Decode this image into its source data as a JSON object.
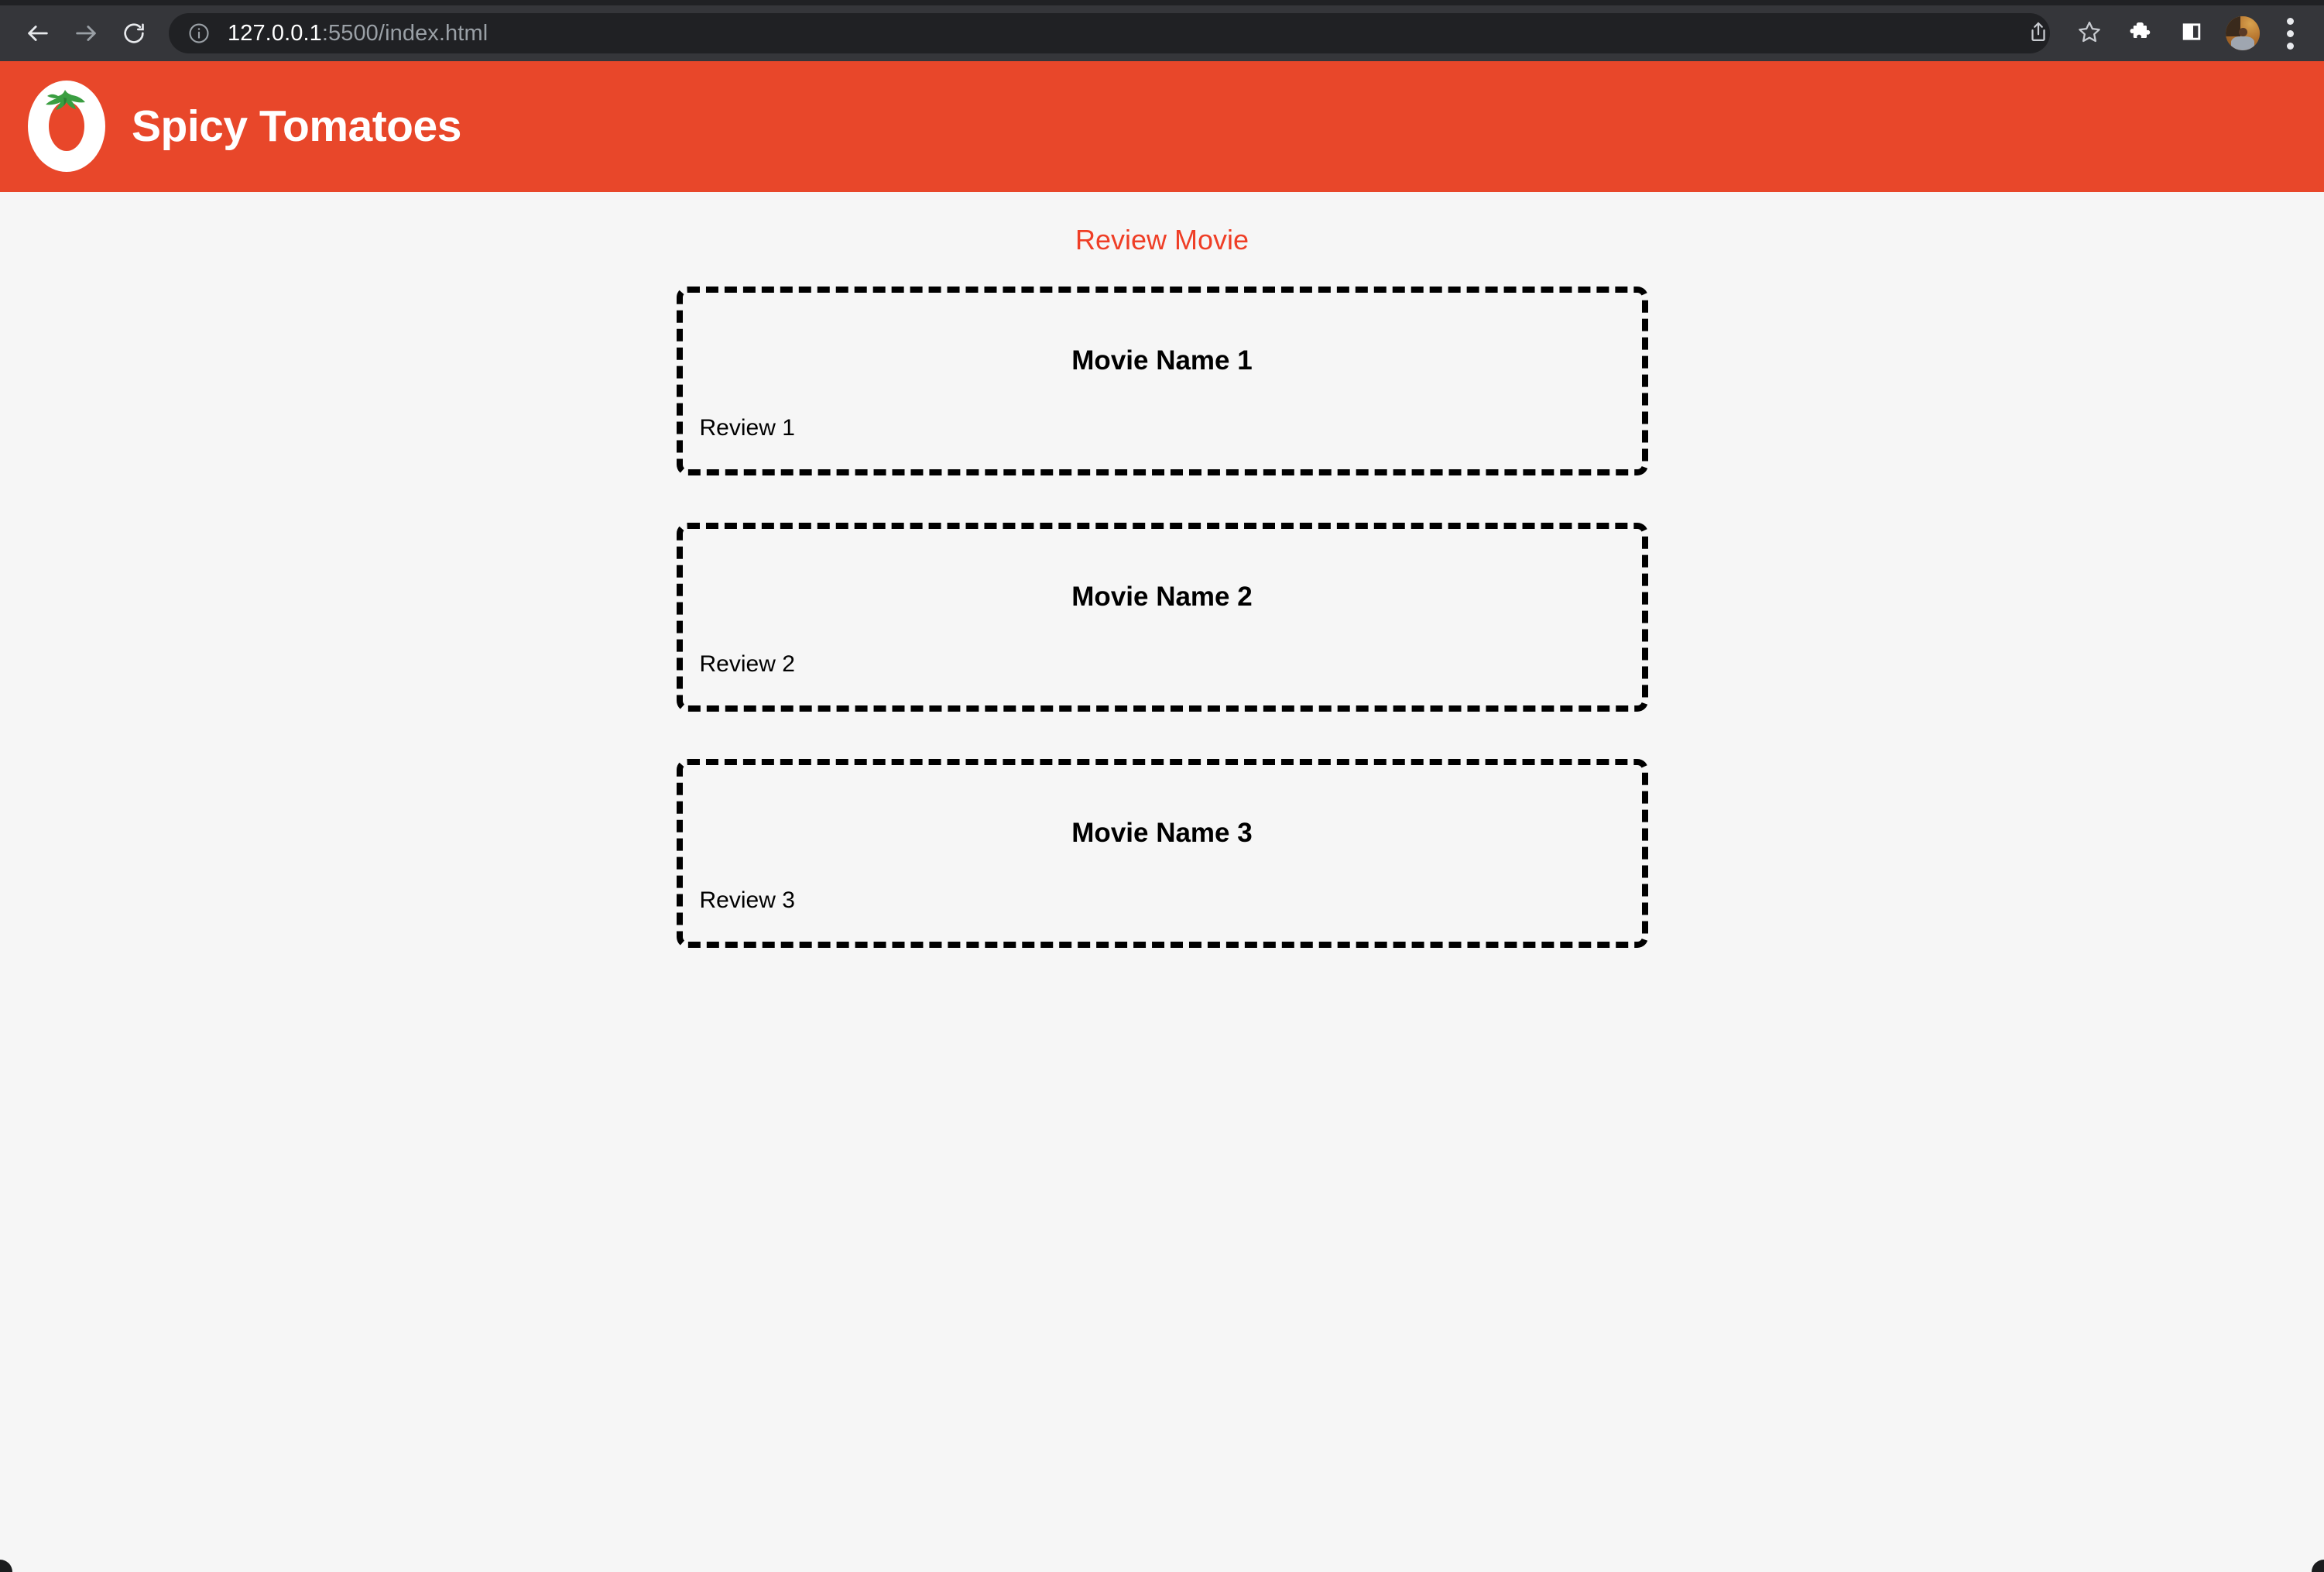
{
  "browser": {
    "back_icon": "back-arrow-icon",
    "forward_icon": "forward-arrow-icon",
    "reload_icon": "reload-icon",
    "site_info_icon": "info-circle-icon",
    "url_host": "127.0.0.1",
    "url_path": ":5500/index.html",
    "url_full": "127.0.0.1:5500/index.html",
    "share_icon": "share-icon",
    "bookmark_icon": "star-icon",
    "extensions_icon": "puzzle-piece-icon",
    "side_panel_icon": "side-panel-icon",
    "profile_icon": "avatar",
    "menu_icon": "three-dot-menu-icon"
  },
  "site": {
    "logo_icon": "tomato-logo-icon",
    "title": "Spicy Tomatoes",
    "header_color": "#E8472A"
  },
  "main": {
    "heading": "Review Movie",
    "heading_color": "#EF3E26",
    "movies": [
      {
        "name": "Movie Name 1",
        "review": "Review 1"
      },
      {
        "name": "Movie Name 2",
        "review": "Review 2"
      },
      {
        "name": "Movie Name 3",
        "review": "Review 3"
      }
    ]
  }
}
